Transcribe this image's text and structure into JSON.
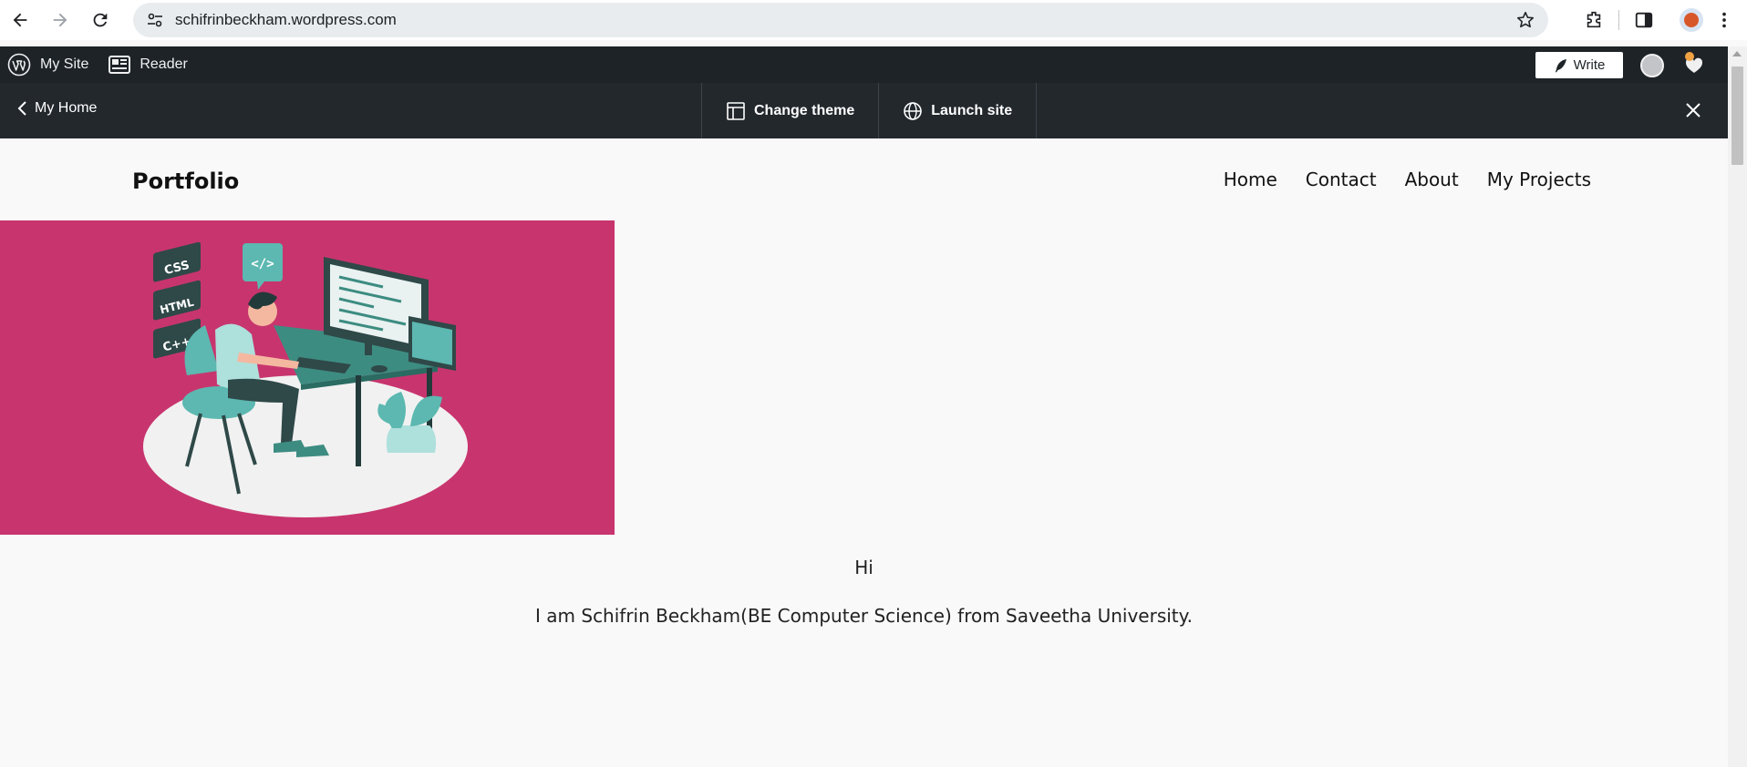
{
  "browser": {
    "url": "schifrinbeckham.wordpress.com",
    "back_icon": "back-arrow-icon",
    "forward_icon": "forward-arrow-icon",
    "reload_icon": "reload-icon",
    "bookmark_icon": "star-icon",
    "extensions_icon": "puzzle-icon",
    "sidepanel_icon": "side-panel-icon",
    "menu_icon": "kebab-menu-icon"
  },
  "admin_bar": {
    "my_site": "My Site",
    "reader": "Reader",
    "write": "Write"
  },
  "launch_bar": {
    "my_home": "My Home",
    "change_theme": "Change theme",
    "launch_site": "Launch site"
  },
  "site": {
    "title": "Portfolio",
    "nav": [
      "Home",
      "Contact",
      "About",
      "My Projects"
    ],
    "hero_bg_color": "#c8356e",
    "hero_badges": [
      "CSS",
      "HTML",
      "C++"
    ],
    "greeting": "Hi",
    "intro": "I am Schifrin Beckham(BE Computer Science) from Saveetha University."
  },
  "colors": {
    "admin_bar": "#1d2327",
    "launch_bar": "#23282d",
    "page_bg": "#f9f9f9"
  }
}
